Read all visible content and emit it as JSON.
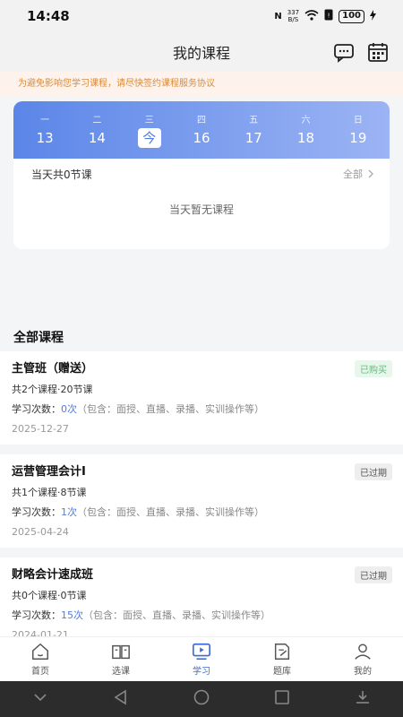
{
  "status": {
    "time": "14:48",
    "nfc": "N",
    "net_speed_top": "337",
    "net_speed_bottom": "B/S",
    "battery": "100"
  },
  "header": {
    "title": "我的课程"
  },
  "notice": "为避免影响您学习课程，请尽快签约课程服务协议",
  "calendar": {
    "days": [
      {
        "weekday": "一",
        "date": "13"
      },
      {
        "weekday": "二",
        "date": "14"
      },
      {
        "weekday": "三",
        "date": "今"
      },
      {
        "weekday": "四",
        "date": "16"
      },
      {
        "weekday": "五",
        "date": "17"
      },
      {
        "weekday": "六",
        "date": "18"
      },
      {
        "weekday": "日",
        "date": "19"
      }
    ],
    "summary": "当天共0节课",
    "all_label": "全部",
    "empty": "当天暂无课程"
  },
  "section_title": "全部课程",
  "courses": [
    {
      "name": "主管班（赠送）",
      "badge": "已购买",
      "info": "共2个课程·20节课",
      "study_label": "学习次数：",
      "count": "0次",
      "detail": "（包含：面授、直播、录播、实训操作等）",
      "date": "2025-12-27"
    },
    {
      "name": "运营管理会计I",
      "badge": "已过期",
      "info": "共1个课程·8节课",
      "study_label": "学习次数：",
      "count": "1次",
      "detail": "（包含：面授、直播、录播、实训操作等）",
      "date": "2025-04-24"
    },
    {
      "name": "财略会计速成班",
      "badge": "已过期",
      "info": "共0个课程·0节课",
      "study_label": "学习次数：",
      "count": "15次",
      "detail": "（包含：面授、直播、录播、实训操作等）",
      "date": "2024-01-21"
    }
  ],
  "tabs": [
    {
      "label": "首页",
      "icon": "home-icon"
    },
    {
      "label": "选课",
      "icon": "book-icon"
    },
    {
      "label": "学习",
      "icon": "play-screen-icon"
    },
    {
      "label": "题库",
      "icon": "edit-icon"
    },
    {
      "label": "我的",
      "icon": "user-icon"
    }
  ],
  "colors": {
    "accent": "#4f7be4",
    "notice_text": "#d98a3c",
    "bought": "#5cbf7c"
  }
}
